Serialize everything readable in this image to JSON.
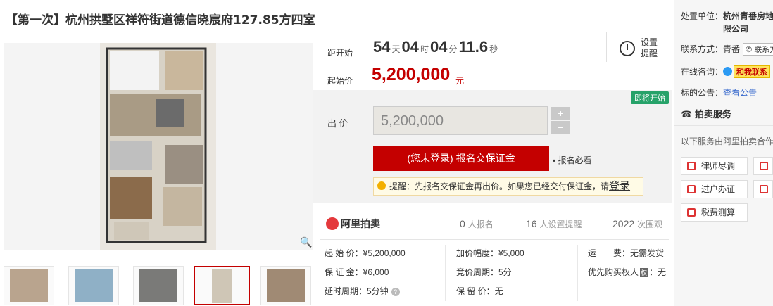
{
  "title": "【第一次】杭州拱墅区祥符街道德信晓宸府127.85方四室",
  "countdown": {
    "label": "距开始",
    "days": "54",
    "days_unit": "天",
    "hours": "04",
    "hours_unit": "时",
    "minutes": "04",
    "minutes_unit": "分",
    "seconds": "11.6",
    "seconds_unit": "秒"
  },
  "set_remind": "设置提醒",
  "start_price": {
    "label": "起始价",
    "value": "5,200,000",
    "unit": "元"
  },
  "status_badge": "即将开始",
  "bid": {
    "label": "出 价",
    "value": "5,200,000",
    "plus": "+",
    "minus": "−",
    "signup_button": "(您未登录) 报名交保证金",
    "must_read": "报名必看",
    "reminder": "提醒：先报名交保证金再出价。如果您已经交付保证金，请",
    "login": "登录"
  },
  "platform": "阿里拍卖",
  "stats": [
    {
      "num": "0",
      "label": "人报名"
    },
    {
      "num": "16",
      "label": "人设置提醒"
    },
    {
      "num": "2022",
      "label": "次围观"
    }
  ],
  "info": {
    "col1": [
      "起 始 价：¥5,200,000",
      "保 证 金：¥6,000",
      "延时周期：5分钟"
    ],
    "col2": [
      "加价幅度：¥5,000",
      "竞价周期：5分",
      "保 留 价：无"
    ],
    "col3": [
      "运　　费：无需发货",
      "优先购买权人",
      "：无"
    ],
    "col3_badge": "权"
  },
  "sidebar": {
    "disposer_label": "处置单位：",
    "disposer_value": "杭州青番房地",
    "disposer_value2": "限公司",
    "contact_label": "联系方式：",
    "contact_value": "青番",
    "contact_btn": "联系方",
    "chat_label": "在线咨询：",
    "chat_btn": "和我联系",
    "notice_label": "标的公告：",
    "notice_link": "查看公告",
    "service_title": "拍卖服务",
    "service_desc": "以下服务由阿里拍卖合作",
    "services": [
      "律师尽调",
      "过户办证",
      "税费测算"
    ]
  },
  "colors": {
    "accent": "#c40000",
    "badge_green": "#26a269",
    "link": "#3366cc"
  }
}
